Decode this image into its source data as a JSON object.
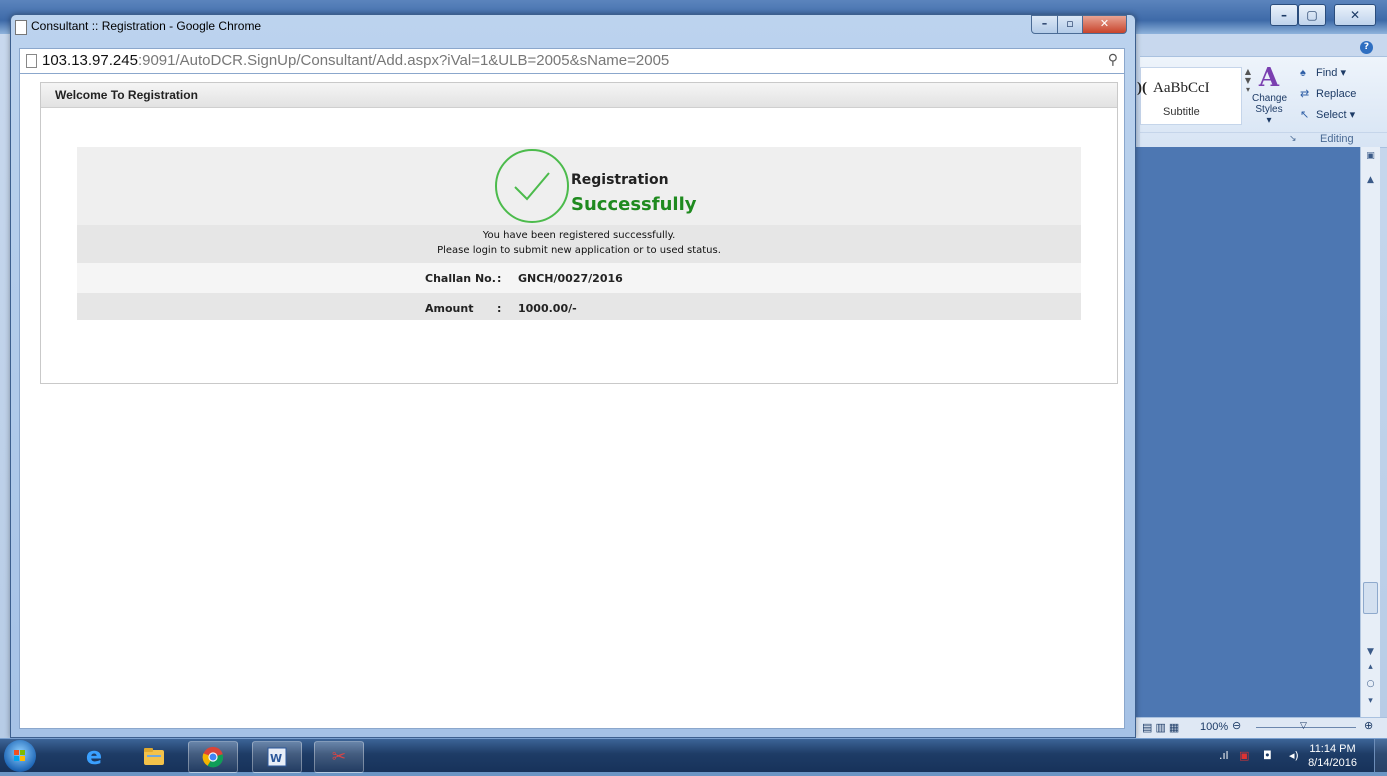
{
  "word": {
    "style_preview": "AaBbCcI",
    "style_preview_prefix": ")(",
    "style_name": "Subtitle",
    "change_styles_line1": "Change",
    "change_styles_line2": "Styles ▾",
    "find": "Find ▾",
    "replace": "Replace",
    "select": "Select ▾",
    "editing_group": "Editing",
    "zoom": "100%",
    "min_btn": "–",
    "max_btn": "▢",
    "close_btn": "✕",
    "help": "?"
  },
  "chrome": {
    "title": "Consultant :: Registration - Google Chrome",
    "url_host": "103.13.97.245",
    "url_rest": ":9091/AutoDCR.SignUp/Consultant/Add.aspx?iVal=1&ULB=2005&sName=2005",
    "min_btn": "–",
    "max_btn": "▫",
    "close_btn": "✕"
  },
  "page": {
    "panel_title": "Welcome To Registration",
    "heading_line1": "Registration",
    "heading_line2": "Successfully",
    "message_line1": "You have been registered successfully.",
    "message_line2": "Please login to submit new application or to used status.",
    "rows": [
      {
        "label": "Challan No.",
        "sep": ":",
        "value": "GNCH/0027/2016"
      },
      {
        "label": "Amount",
        "sep": ":",
        "value": "1000.00/-"
      }
    ],
    "success_color": "#1f8a1f"
  },
  "taskbar": {
    "items": [
      "start-orb",
      "internet-explorer-icon",
      "file-explorer-icon",
      "chrome-icon",
      "word-icon",
      "snipping-tool-icon"
    ],
    "time": "11:14 PM",
    "date": "8/14/2016"
  }
}
